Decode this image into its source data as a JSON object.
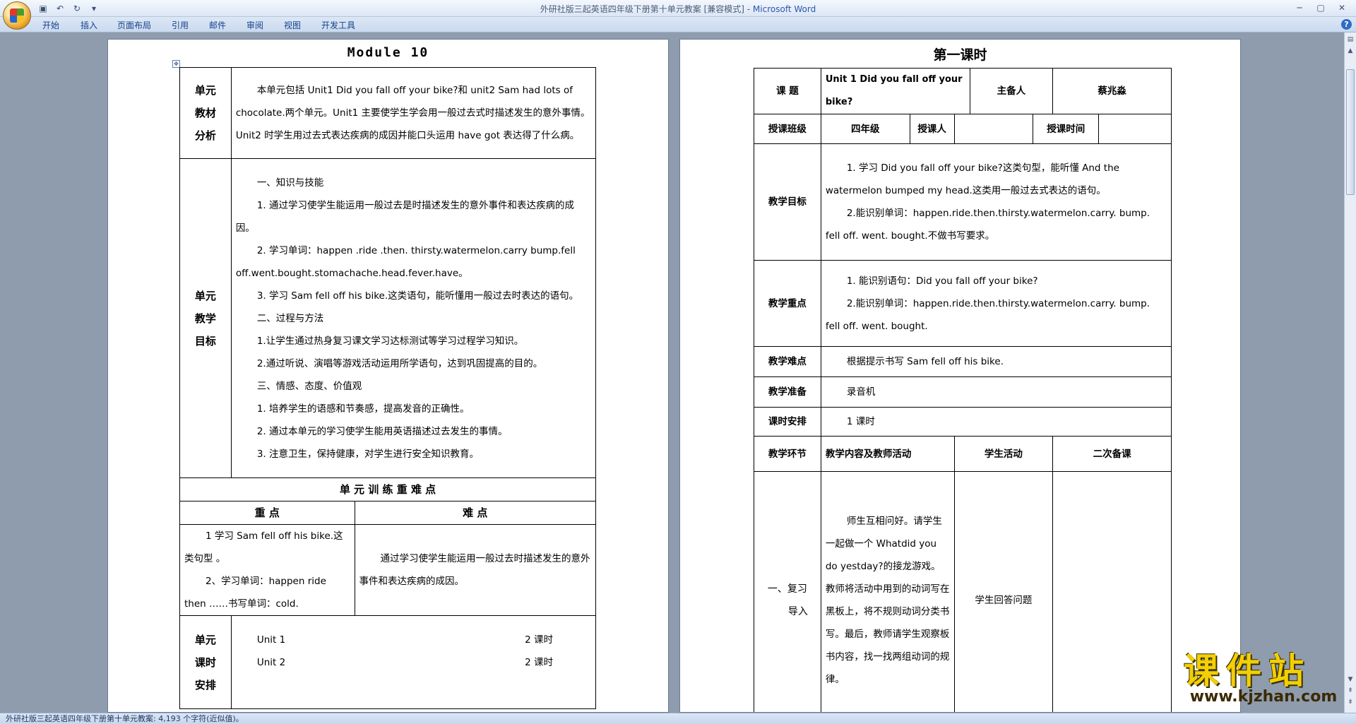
{
  "window": {
    "doc_title": "外研社版三起英语四年级下册第十单元教案 [兼容模式] - ",
    "app_name": "Microsoft Word"
  },
  "ribbon": {
    "tabs": [
      "开始",
      "插入",
      "页面布局",
      "引用",
      "邮件",
      "审阅",
      "视图",
      "开发工具"
    ]
  },
  "status": {
    "text": "外研社版三起英语四年级下册第十单元教案: 4,193 个字符(近似值)。"
  },
  "page1": {
    "title": "Module 10",
    "analysis": {
      "label": [
        "单元",
        "教材",
        "分析"
      ],
      "text": "本单元包括 Unit1 Did you fall off  your  bike?和 unit2 Sam had lots of chocolate.两个单元。Unit1 主要使学生学会用一般过去式时描述发生的意外事情。Unit2 时学生用过去式表达疾病的成因并能口头运用 have got 表达得了什么病。"
    },
    "goals": {
      "label": [
        "单元",
        "教学",
        "目标"
      ],
      "lines": [
        "一、知识与技能",
        "1. 通过学习使学生能运用一般过去是时描述发生的意外事件和表达疾病的成因。",
        "2. 学习单词：happen .ride .then.  thirsty.watermelon.carry bump.fell off.went.bought.stomachache.head.fever.have。",
        "3. 学习 Sam fell off his bike.这类语句，能听懂用一般过去时表达的语句。",
        "二、过程与方法",
        "1.让学生通过热身复习课文学习达标测试等学习过程学习知识。",
        "2.通过听说、演唱等游戏活动运用所学语句，达到巩固提高的目的。",
        "三、情感、态度、价值观",
        "1. 培养学生的语感和节奏感，提高发音的正确性。",
        "2. 通过本单元的学习使学生能用英语描述过去发生的事情。",
        "3. 注意卫生，保持健康，对学生进行安全知识教育。"
      ]
    },
    "keypoints": {
      "header": "单 元 训 练 重 难 点",
      "col_key": "重      点",
      "col_diff": "难      点",
      "key_lines": [
        "1 学习 Sam  fell  off  his bike.这类句型 。",
        "2、学习单词：happen ride then ……书写单词：cold."
      ],
      "diff_text": "通过学习使学生能运用一般过去时描述发生的意外事件和表达疾病的成因。"
    },
    "schedule": {
      "label": [
        "单元",
        "课时",
        "安排"
      ],
      "rows": [
        {
          "unit": "Unit 1",
          "hours": "2 课时"
        },
        {
          "unit": "Unit 2",
          "hours": "2 课时"
        }
      ]
    }
  },
  "page2": {
    "title": "第一课时",
    "row1": {
      "k1": "课    题",
      "v1": "Unit 1  Did you fall off  your  bike?",
      "k2": "主备人",
      "v2": "蔡兆淼"
    },
    "row2": {
      "k1": "授课班级",
      "v1": "四年级",
      "k2": "授课人",
      "v2": "",
      "k3": "授课时间",
      "v3": ""
    },
    "objectives": {
      "label": "教学目标",
      "lines": [
        "1. 学习 Did you fall off  your  bike?这类句型，能听懂 And the watermelon bumped my head.这类用一般过去式表达的语句。",
        "2.能识别单词：happen.ride.then.thirsty.watermelon.carry. bump. fell off. went. bought.不做书写要求。"
      ]
    },
    "keypoints": {
      "label": "教学重点",
      "lines": [
        "1. 能识别语句：Did you fall off  your  bike?",
        "2.能识别单词：happen.ride.then.thirsty.watermelon.carry. bump. fell off. went. bought."
      ]
    },
    "difficulty": {
      "label": "教学难点",
      "text": "根据提示书写 Sam fell off his bike."
    },
    "prep": {
      "label": "教学准备",
      "text": "录音机"
    },
    "hours": {
      "label": "课时安排",
      "text": "1 课时"
    },
    "stage_header": {
      "c1": "教学环节",
      "c2": "教学内容及教师活动",
      "c3": "学生活动",
      "c4": "二次备课"
    },
    "stage1": {
      "label": [
        "一、复习",
        "导入"
      ],
      "content": "师生互相问好。请学生一起做一个 Whatdid you do yestday?的接龙游戏。教师将活动中用到的动词写在黑板上，将不规则动词分类书写。最后，教师请学生观察板书内容，找一找两组动词的规律。",
      "student": "学生回答问题",
      "notes": ""
    }
  },
  "watermark": {
    "top": "课件站",
    "bottom": "www.kjzhan.com"
  }
}
